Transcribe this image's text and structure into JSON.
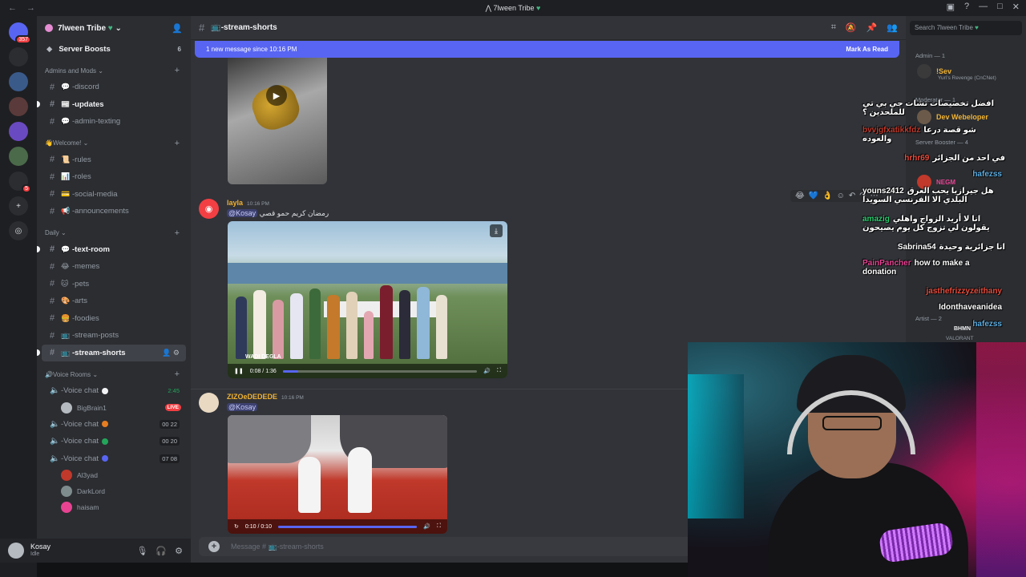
{
  "window": {
    "title": "7lween Tribe"
  },
  "guilds": [
    {
      "label": "",
      "badge": "357",
      "color": "#5865f2"
    },
    {
      "label": "",
      "badge": "",
      "color": "#2b2d31"
    },
    {
      "label": "",
      "badge": "",
      "color": "#3a5a8a"
    },
    {
      "label": "",
      "badge": "",
      "color": "#5a3a3a"
    },
    {
      "label": "",
      "badge": "",
      "color": "#6a4ac0"
    },
    {
      "label": "",
      "badge": "",
      "color": "#4a6a4a"
    },
    {
      "label": "",
      "badge": "5",
      "color": "#2b2d31"
    }
  ],
  "server": {
    "name": "7lween Tribe",
    "boosts_label": "Server Boosts",
    "boosts_count": "6",
    "categories": [
      {
        "name": "Admins and Mods",
        "channels": [
          {
            "name": "-discord",
            "emoji": "💬",
            "unread": false
          },
          {
            "name": "-updates",
            "emoji": "📰",
            "unread": true
          },
          {
            "name": "-admin-texting",
            "emoji": "💬",
            "unread": false
          }
        ]
      },
      {
        "name": "👋Welcome!",
        "channels": [
          {
            "name": "-rules",
            "emoji": "📜",
            "unread": false
          },
          {
            "name": "-roles",
            "emoji": "📊",
            "unread": false
          },
          {
            "name": "-social-media",
            "emoji": "💳",
            "unread": false
          },
          {
            "name": "-announcements",
            "emoji": "📢",
            "unread": false
          }
        ]
      },
      {
        "name": "Daily",
        "channels": [
          {
            "name": "-text-room",
            "emoji": "💬",
            "unread": true
          },
          {
            "name": "-memes",
            "emoji": "😂",
            "unread": false
          },
          {
            "name": "-pets",
            "emoji": "🐱",
            "unread": false
          },
          {
            "name": "-arts",
            "emoji": "🎨",
            "unread": false
          },
          {
            "name": "-foodies",
            "emoji": "🍔",
            "unread": false
          },
          {
            "name": "-stream-posts",
            "emoji": "📺",
            "unread": false
          },
          {
            "name": "-stream-shorts",
            "emoji": "📺",
            "unread": false,
            "active": true
          }
        ]
      }
    ],
    "voice_category": "🔊Voice Rooms",
    "voice": [
      {
        "name": "-Voice chat",
        "right": "2:45",
        "dot": "#f2f3f5",
        "users": [
          {
            "name": "BigBrain1",
            "live": "LIVE",
            "color": "#b5bac1"
          }
        ]
      },
      {
        "name": "-Voice chat",
        "right": "00  22",
        "dot": "#e67e22",
        "users": []
      },
      {
        "name": "-Voice chat",
        "right": "00  20",
        "dot": "#23a55a",
        "users": []
      },
      {
        "name": "-Voice chat",
        "right": "07  08",
        "dot": "#5865f2",
        "users": [
          {
            "name": "Al3yad",
            "live": "",
            "color": "#c0392b"
          },
          {
            "name": "DarkLord",
            "live": "",
            "color": "#7f8c8d"
          },
          {
            "name": "haisam",
            "live": "",
            "color": "#e84393"
          }
        ]
      }
    ]
  },
  "user": {
    "name": "Kosay",
    "status": "Idle"
  },
  "channel": {
    "name": "-stream-shorts",
    "banner_text": "1 new message since 10:16 PM",
    "mark_as_read": "Mark As Read",
    "input_placeholder": "Message # 📺-stream-shorts"
  },
  "messages": [
    {
      "author": "layla",
      "color": "#f0b232",
      "time": "10:16 PM",
      "mention": "@Kosay",
      "text": "رمضان كريم حمو قصي",
      "video_time": "0:08 / 1:36",
      "progress": 0.08,
      "caption": "WADI DEGLA"
    },
    {
      "author": "ZIZOeDEDEDE",
      "color": "#f0b232",
      "time": "10:16 PM",
      "mention": "@Kosay",
      "text": "",
      "video_time": "0:10 / 0:10",
      "progress": 1.0
    }
  ],
  "members": {
    "search_placeholder": "Search 7lween Tribe",
    "groups": [
      {
        "title": "Admin — 1"
      },
      {
        "title": "Moderator — 1"
      },
      {
        "title": "Server Booster — 4"
      },
      {
        "title": "Artist — 2"
      }
    ],
    "list": [
      {
        "name": "!Sev",
        "sub": "Yuri's Revenge (CnCNet)",
        "color": "#f0b232"
      },
      {
        "name": "Dev Webeloper",
        "sub": "",
        "color": "#f0b232"
      },
      {
        "name": "NEGM",
        "sub": "",
        "color": "#e84393"
      },
      {
        "name": "BHMN",
        "sub": "VALORANT",
        "color": "#f2f3f5"
      }
    ]
  },
  "overlay_chat": [
    {
      "user": "",
      "color": "#ffffff",
      "text": "افضل تخصيصات تشات جي بي تي للملحدين ؟"
    },
    {
      "user": "bvvjgfxatikkfdz",
      "color": "#c0392b",
      "text": "شو قصة درعا والعوده"
    },
    {
      "user": "hrhr69",
      "color": "#e74c3c",
      "text": "في احد من الجزائر"
    },
    {
      "user": "hafezss",
      "color": "#5dade2",
      "text": ""
    },
    {
      "user": "youns2412",
      "color": "#ffffff",
      "text": "هل جيرازيا يحب العرق البلدي الا الفرنسي السويدا"
    },
    {
      "user": "amazig",
      "color": "#2ecc71",
      "text": "انا لا أريد الزواج واهلي يقولون لي تزوج كل يوم يصيحون"
    },
    {
      "user": "Sabrina54",
      "color": "#ffffff",
      "text": "انا جزائرية وحيدة"
    },
    {
      "user": "PainPancher",
      "color": "#e84393",
      "text": "how to make a donation"
    },
    {
      "user": "jasthefrizzyzeithany",
      "color": "#e74c3c",
      "text": ""
    },
    {
      "user": "Idonthaveanidea",
      "color": "#ffffff",
      "text": ""
    },
    {
      "user": "hafezss",
      "color": "#5dade2",
      "text": ""
    }
  ],
  "colors": {
    "accent": "#5865f2",
    "live": "#f23f43",
    "online": "#23a55a"
  }
}
